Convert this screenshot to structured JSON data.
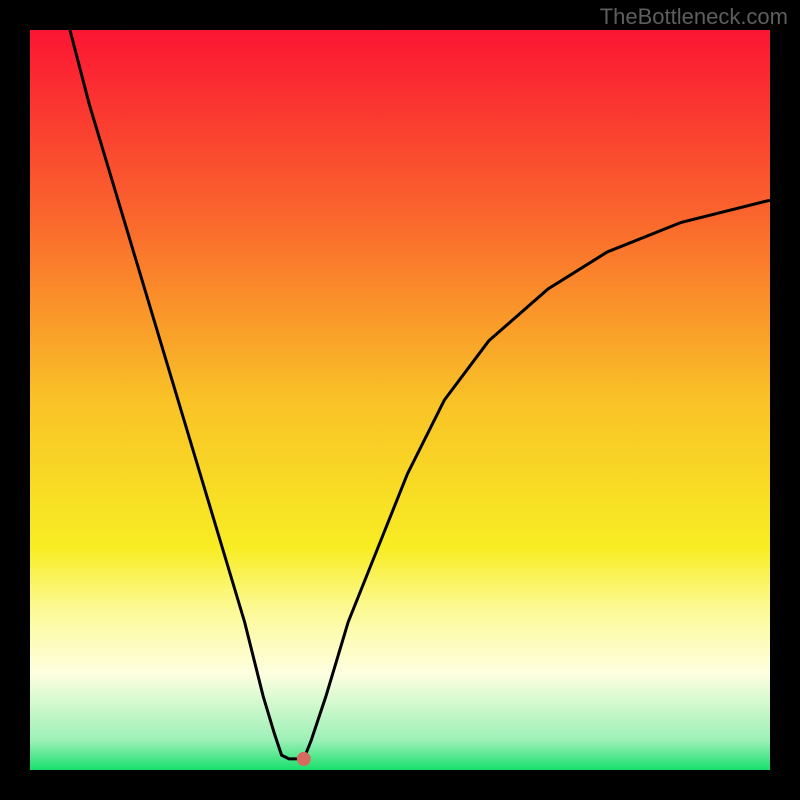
{
  "watermark": "TheBottleneck.com",
  "chart_data": {
    "type": "line",
    "title": "",
    "xlabel": "",
    "ylabel": "",
    "xlim": [
      0,
      100
    ],
    "ylim": [
      0,
      100
    ],
    "gradient_stops": [
      {
        "offset": 0.0,
        "color": "#fb1533"
      },
      {
        "offset": 0.25,
        "color": "#fa652d"
      },
      {
        "offset": 0.5,
        "color": "#f9c227"
      },
      {
        "offset": 0.7,
        "color": "#f8ed23"
      },
      {
        "offset": 0.78,
        "color": "#fcf992"
      },
      {
        "offset": 0.87,
        "color": "#feffe1"
      },
      {
        "offset": 0.96,
        "color": "#9cf0b7"
      },
      {
        "offset": 1.0,
        "color": "#17df6b"
      }
    ],
    "curve": [
      {
        "x": 5.4,
        "y": 100.0
      },
      {
        "x": 8.0,
        "y": 90.0
      },
      {
        "x": 11.0,
        "y": 80.0
      },
      {
        "x": 14.0,
        "y": 70.0
      },
      {
        "x": 17.0,
        "y": 60.0
      },
      {
        "x": 20.0,
        "y": 50.0
      },
      {
        "x": 23.0,
        "y": 40.0
      },
      {
        "x": 26.0,
        "y": 30.0
      },
      {
        "x": 29.0,
        "y": 20.0
      },
      {
        "x": 31.5,
        "y": 10.0
      },
      {
        "x": 33.0,
        "y": 5.0
      },
      {
        "x": 34.0,
        "y": 2.0
      },
      {
        "x": 35.0,
        "y": 1.5
      },
      {
        "x": 36.0,
        "y": 1.5
      },
      {
        "x": 37.0,
        "y": 1.5
      },
      {
        "x": 38.0,
        "y": 4.0
      },
      {
        "x": 40.0,
        "y": 10.0
      },
      {
        "x": 43.0,
        "y": 20.0
      },
      {
        "x": 47.0,
        "y": 30.0
      },
      {
        "x": 51.0,
        "y": 40.0
      },
      {
        "x": 56.0,
        "y": 50.0
      },
      {
        "x": 62.0,
        "y": 58.0
      },
      {
        "x": 70.0,
        "y": 65.0
      },
      {
        "x": 78.0,
        "y": 70.0
      },
      {
        "x": 88.0,
        "y": 74.0
      },
      {
        "x": 100.0,
        "y": 77.0
      }
    ],
    "marker": {
      "x": 37.0,
      "y": 1.5,
      "color": "#d66a5f"
    }
  }
}
